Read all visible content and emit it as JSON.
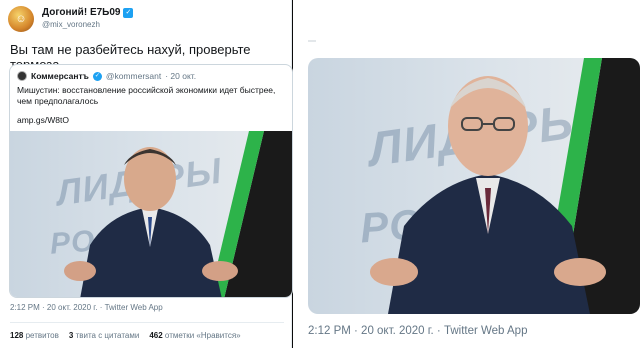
{
  "tweet": {
    "author_name": "Догоний! Е7Ь09",
    "author_handle": "@mix_voronezh",
    "text": "Вы там не разбейтесь нахуй, проверьте тормоза.",
    "meta": "2:12 PM · 20 окт. 2020 г. · Twitter Web App",
    "stats": {
      "retweets_count": "128",
      "retweets_label": "ретвитов",
      "quotes_count": "3",
      "quotes_label": "твита с цитатами",
      "likes_count": "462",
      "likes_label": "отметки «Нравится»"
    }
  },
  "quoted": {
    "name": "Коммерсантъ",
    "handle": "@kommersant",
    "date": "· 20 окт.",
    "text": "Мишустин: восстановление российской экономики идет быстрее, чем предполагалось",
    "link": "amp.gs/W8tO"
  },
  "right_panel": {
    "meta": "2:12 PM · 20 окт. 2020 г. · Twitter Web App"
  },
  "colors": {
    "accent": "#1da1f2",
    "secondary_text": "#657786",
    "border": "#ccd6dd"
  }
}
